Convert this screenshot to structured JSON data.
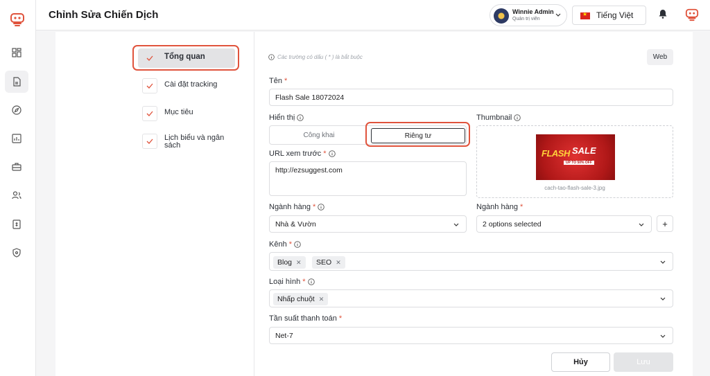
{
  "header": {
    "title": "Chỉnh Sửa Chiến Dịch",
    "user": {
      "name": "Winnie Admin",
      "role": "Quản trị viên"
    },
    "language": "Tiếng Việt"
  },
  "rail": {
    "icons": [
      "dashboard-icon",
      "campaign-icon",
      "explore-icon",
      "report-icon",
      "briefcase-icon",
      "users-icon",
      "invoice-icon",
      "shield-icon"
    ]
  },
  "steps": [
    {
      "label": "Tổng quan",
      "active": true
    },
    {
      "label": "Cài đặt tracking"
    },
    {
      "label": "Mục tiêu"
    },
    {
      "label": "Lịch biểu và ngân sách"
    }
  ],
  "form": {
    "required_note": "Các trường có dấu ( * ) là bắt buộc",
    "platform_button": "Web",
    "name": {
      "label": "Tên",
      "value": "Flash Sale 18072024"
    },
    "visibility": {
      "label": "Hiển thị",
      "options": [
        "Công khai",
        "Riêng tư"
      ],
      "selected": "Riêng tư"
    },
    "thumbnail": {
      "label": "Thumbnail",
      "filename": "cach-tao-flash-sale-3.jpg",
      "image_text": [
        "FLASH",
        "SALE",
        "UP TO 50% OFF"
      ]
    },
    "preview_url": {
      "label": "URL xem trước",
      "value": "http://ezsuggest.com"
    },
    "industry": {
      "label": "Ngành hàng",
      "value": "Nhà & Vườn"
    },
    "industry2": {
      "label": "Ngành hàng",
      "value": "2 options selected",
      "add": "+"
    },
    "channel": {
      "label": "Kênh",
      "tags": [
        "Blog",
        "SEO"
      ]
    },
    "type": {
      "label": "Loại hình",
      "tags": [
        "Nhấp chuột"
      ]
    },
    "payment": {
      "label": "Tần suất thanh toán",
      "value": "Net-7"
    },
    "cancel_label": "Hủy",
    "save_label": "Lưu"
  },
  "colors": {
    "accent": "#e0533c",
    "brand": "#e0533c"
  }
}
